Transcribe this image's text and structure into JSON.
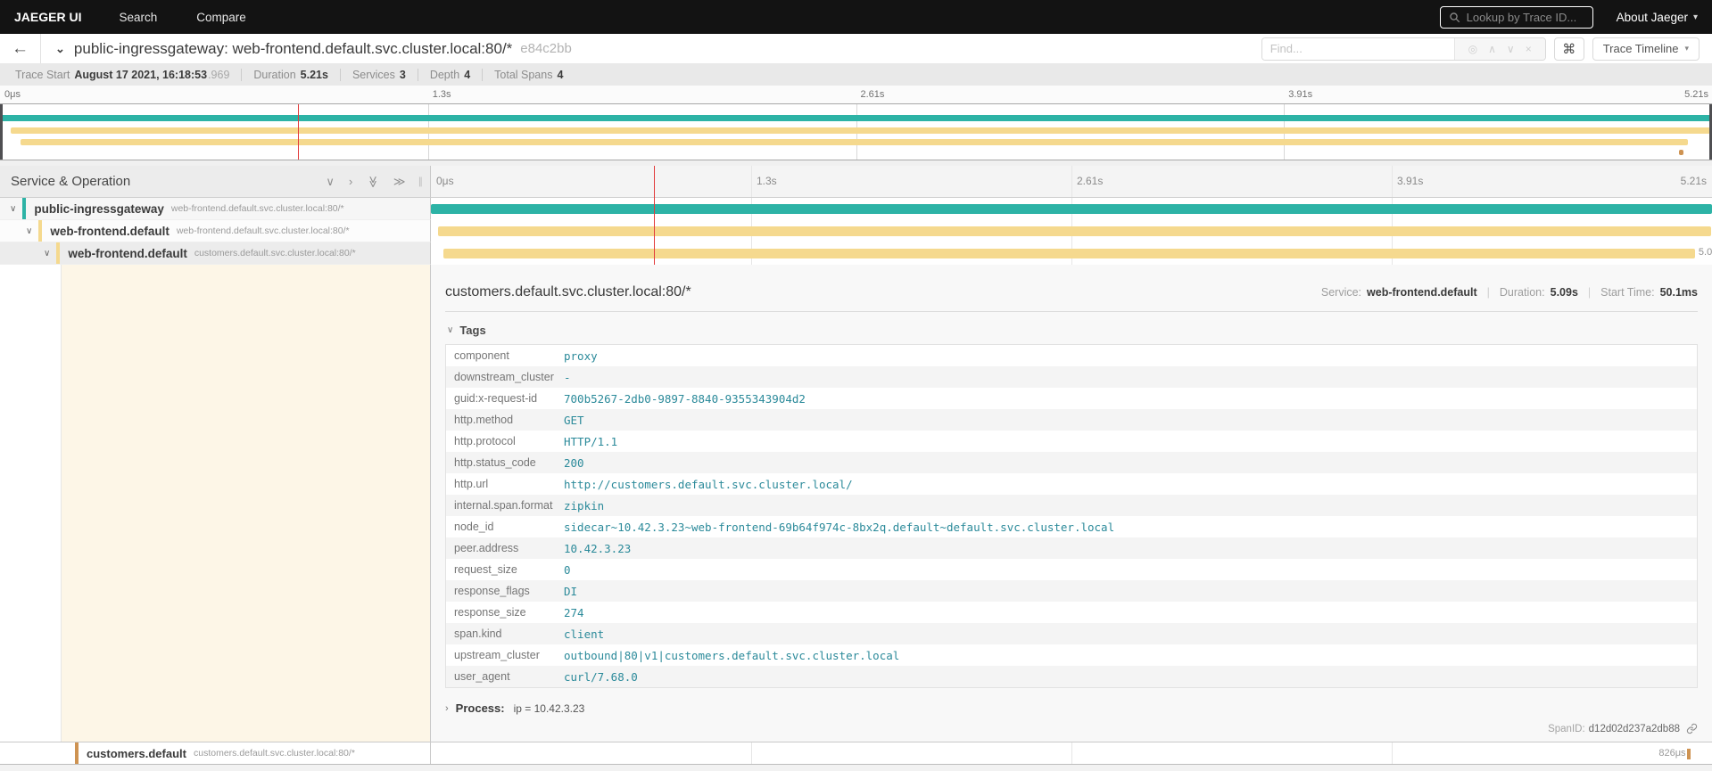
{
  "nav": {
    "brand": "JAEGER UI",
    "items": [
      "Search",
      "Compare"
    ],
    "lookup_placeholder": "Lookup by Trace ID...",
    "about": "About Jaeger"
  },
  "trace_header": {
    "title": "public-ingressgateway: web-frontend.default.svc.cluster.local:80/*",
    "trace_id": "e84c2bb",
    "find_placeholder": "Find...",
    "view_selector": "Trace Timeline"
  },
  "stats": {
    "trace_start_label": "Trace Start",
    "trace_start": "August 17 2021, 16:18:53",
    "trace_start_ms": ".969",
    "duration_label": "Duration",
    "duration": "5.21s",
    "services_label": "Services",
    "services": "3",
    "depth_label": "Depth",
    "depth": "4",
    "total_spans_label": "Total Spans",
    "total_spans": "4"
  },
  "timeline": {
    "header": "Service & Operation",
    "ticks": [
      "0μs",
      "1.3s",
      "2.61s",
      "3.91s",
      "5.21s"
    ]
  },
  "colors": {
    "teal": "#2db3a6",
    "orange": "#f5d98e",
    "tan": "#ce9352",
    "cursor_red": "#e23b3b"
  },
  "spans": [
    {
      "service": "public-ingressgateway",
      "operation": "web-frontend.default.svc.cluster.local:80/*",
      "color": "#2db3a6",
      "bar": {
        "left": "0%",
        "width": "100%"
      }
    },
    {
      "service": "web-frontend.default",
      "operation": "web-frontend.default.svc.cluster.local:80/*",
      "color": "#f5d98e",
      "bar": {
        "left": "0.55%",
        "width": "99.35%"
      }
    },
    {
      "service": "web-frontend.default",
      "operation": "customers.default.svc.cluster.local:80/*",
      "color": "#f5d98e",
      "bar": {
        "left": "0.95%",
        "width": "97.75%"
      },
      "duration_label": "5.0"
    },
    {
      "service": "customers.default",
      "operation": "customers.default.svc.cluster.local:80/*",
      "color": "#ce9352",
      "bar": {
        "left": "98.05%",
        "width": "0.3%"
      },
      "duration_label": "826μs"
    }
  ],
  "detail": {
    "operation": "customers.default.svc.cluster.local:80/*",
    "service_label": "Service:",
    "service": "web-frontend.default",
    "duration_label": "Duration:",
    "duration": "5.09s",
    "start_label": "Start Time:",
    "start_time": "50.1ms",
    "tags_label": "Tags",
    "tags": [
      {
        "key": "component",
        "value": "proxy"
      },
      {
        "key": "downstream_cluster",
        "value": "-"
      },
      {
        "key": "guid:x-request-id",
        "value": "700b5267-2db0-9897-8840-9355343904d2"
      },
      {
        "key": "http.method",
        "value": "GET"
      },
      {
        "key": "http.protocol",
        "value": "HTTP/1.1"
      },
      {
        "key": "http.status_code",
        "value": "200"
      },
      {
        "key": "http.url",
        "value": "http://customers.default.svc.cluster.local/"
      },
      {
        "key": "internal.span.format",
        "value": "zipkin"
      },
      {
        "key": "node_id",
        "value": "sidecar~10.42.3.23~web-frontend-69b64f974c-8bx2q.default~default.svc.cluster.local"
      },
      {
        "key": "peer.address",
        "value": "10.42.3.23"
      },
      {
        "key": "request_size",
        "value": "0"
      },
      {
        "key": "response_flags",
        "value": "DI"
      },
      {
        "key": "response_size",
        "value": "274"
      },
      {
        "key": "span.kind",
        "value": "client"
      },
      {
        "key": "upstream_cluster",
        "value": "outbound|80|v1|customers.default.svc.cluster.local"
      },
      {
        "key": "user_agent",
        "value": "curl/7.68.0"
      }
    ],
    "process_label": "Process:",
    "process": "ip = 10.42.3.23",
    "span_id_label": "SpanID:",
    "span_id": "d12d02d237a2db88"
  }
}
